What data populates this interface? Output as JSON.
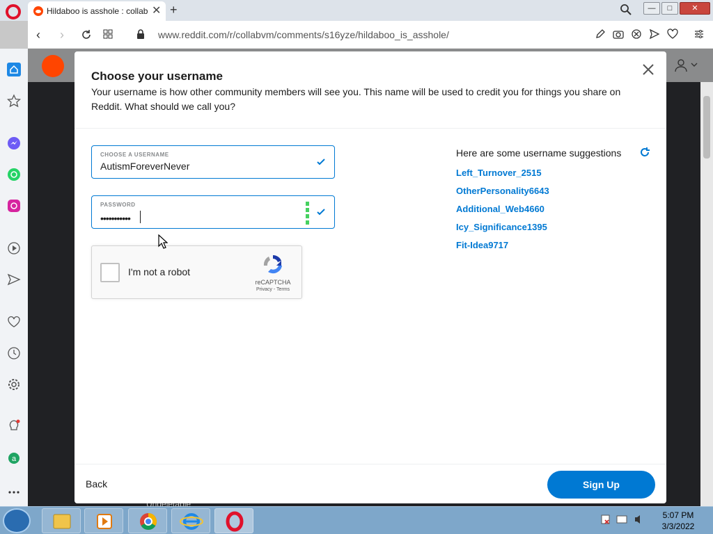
{
  "browser": {
    "tab_title": "Hildaboo is asshole : collab",
    "tab_close": "✕",
    "new_tab": "+",
    "url": "www.reddit.com/r/collabvm/comments/s16yze/hildaboo_is_asshole/"
  },
  "modal": {
    "title": "Choose your username",
    "description": "Your username is how other community members will see you. This name will be used to credit you for things you share on Reddit. What should we call you?",
    "username_label": "CHOOSE A USERNAME",
    "username_value": "AutismForeverNever",
    "password_label": "PASSWORD",
    "password_dots": "•••••••••••",
    "captcha_label": "I'm not a robot",
    "captcha_brand": "reCAPTCHA",
    "captcha_links": "Privacy - Terms",
    "suggestions_heading": "Here are some username suggestions",
    "suggestions": [
      "Left_Turnover_2515",
      "OtherPersonality6643",
      "Additional_Web4660",
      "Icy_Significance1395",
      "Fit-Idea9717"
    ],
    "back_label": "Back",
    "signup_label": "Sign Up"
  },
  "background": {
    "fragment": "Undeletable"
  },
  "taskbar": {
    "time": "5:07 PM",
    "date": "3/3/2022"
  },
  "colors": {
    "reddit_blue": "#0079d3",
    "reddit_orange": "#ff4500",
    "opera_red": "#e0112b"
  }
}
